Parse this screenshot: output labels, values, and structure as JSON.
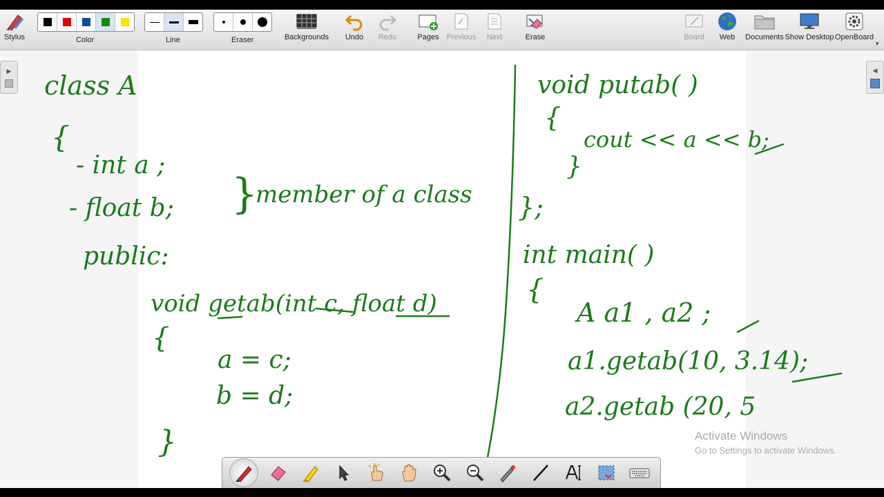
{
  "toolbar": {
    "stylus_label": "Stylus",
    "color_label": "Color",
    "line_label": "Line",
    "eraser_label": "Eraser",
    "backgrounds_label": "Backgrounds",
    "undo_label": "Undo",
    "redo_label": "Redo",
    "pages_label": "Pages",
    "previous_label": "Previous",
    "next_label": "Next",
    "erase_label": "Erase",
    "board_label": "Board",
    "web_label": "Web",
    "documents_label": "Documents",
    "show_desktop_label": "Show Desktop",
    "openboard_label": "OpenBoard",
    "colors": [
      "#000000",
      "#e00000",
      "#0b4a9e",
      "#128a12",
      "#ffe000"
    ],
    "selected_color": "#128a12",
    "ink_color": "#1a7a1a"
  },
  "watermark": {
    "title": "Activate Windows",
    "subtitle": "Go to Settings to activate Windows."
  },
  "handwriting": {
    "left": {
      "class_decl": "class A",
      "open_brace": "{",
      "member_a": "- int a ;",
      "member_b": "- float b;",
      "members_note": "member of a class",
      "access": "public:",
      "method_sig": "void getab(int c, float d)",
      "method_open": "{",
      "assign_a": "a = c;",
      "assign_b": "b = d;",
      "method_close": "}"
    },
    "right": {
      "put_sig": "void putab( )",
      "put_open": "{",
      "cout_line": "cout << a << b;",
      "inner_brace": "}",
      "class_close": "};",
      "main_sig": "int main( )",
      "main_open": "{",
      "objects": "A a1 , a2 ;",
      "call1": "a1.getab(10, 3.14);",
      "call2": "a2.getab (20, 5"
    }
  }
}
